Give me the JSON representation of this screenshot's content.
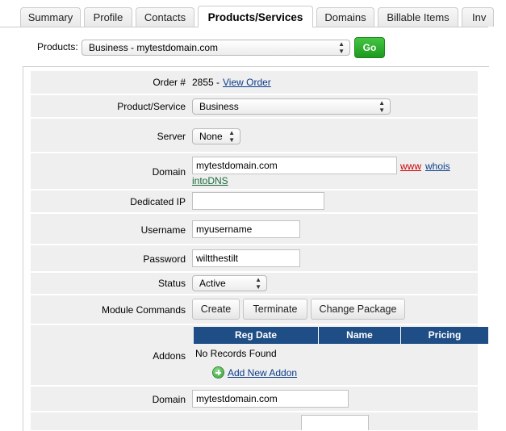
{
  "tabs": [
    {
      "label": "Summary"
    },
    {
      "label": "Profile"
    },
    {
      "label": "Contacts"
    },
    {
      "label": "Products/Services"
    },
    {
      "label": "Domains"
    },
    {
      "label": "Billable Items"
    },
    {
      "label": "Inv"
    }
  ],
  "products_bar": {
    "label": "Products:",
    "selected": "Business - mytestdomain.com",
    "go_label": "Go"
  },
  "fields": {
    "order": {
      "label": "Order #",
      "number": "2855 -",
      "link": "View Order"
    },
    "product": {
      "label": "Product/Service",
      "value": "Business"
    },
    "server": {
      "label": "Server",
      "value": "None"
    },
    "domain": {
      "label": "Domain",
      "value": "mytestdomain.com",
      "link_www": "www",
      "link_whois": "whois",
      "link_intodns": "intoDNS"
    },
    "dedicated_ip": {
      "label": "Dedicated IP",
      "value": ""
    },
    "username": {
      "label": "Username",
      "value": "myusername"
    },
    "password": {
      "label": "Password",
      "value": "wiltthestilt"
    },
    "status": {
      "label": "Status",
      "value": "Active"
    }
  },
  "module_commands": {
    "label": "Module Commands",
    "create": "Create",
    "terminate": "Terminate",
    "change_package": "Change Package"
  },
  "addons": {
    "label": "Addons",
    "columns": [
      "Reg Date",
      "Name",
      "Pricing"
    ],
    "empty_text": "No Records Found",
    "add_link": "Add New Addon"
  },
  "domain2": {
    "label": "Domain",
    "value": "mytestdomain.com"
  },
  "colors": {
    "header_blue": "#1f4e86",
    "go_green": "#2aa52a",
    "row_gray": "#efefef",
    "link_red": "#cc0000",
    "link_green": "#1a6b3a"
  }
}
